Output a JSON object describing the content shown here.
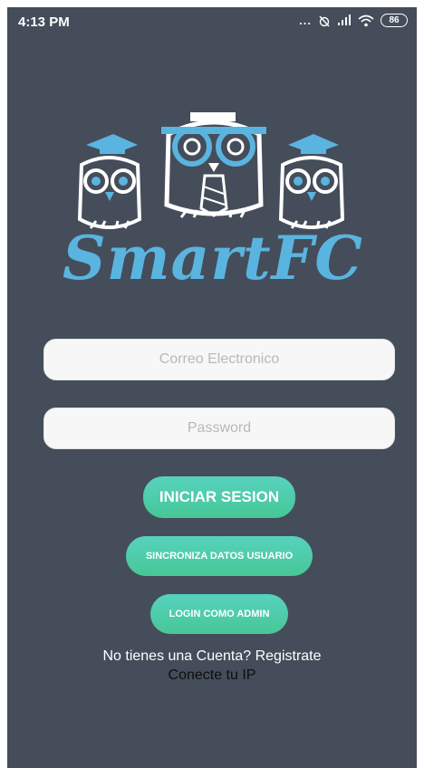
{
  "status_bar": {
    "time": "4:13 PM",
    "signal_dots": "...",
    "battery_level": "86"
  },
  "logo": {
    "text": "SmartFC",
    "color": "#5ab4e0"
  },
  "form": {
    "email_placeholder": "Correo Electronico",
    "password_placeholder": "Password"
  },
  "buttons": {
    "login_label": "INICIAR SESION",
    "sync_label": "SINCRONIZA DATOS USUARIO",
    "admin_label": "LOGIN COMO ADMIN"
  },
  "links": {
    "register": "No tienes una Cuenta? Registrate",
    "connect_ip": "Conecte tu IP"
  },
  "colors": {
    "background": "#454d5a",
    "button_gradient_top": "#57d2bf",
    "button_gradient_bottom": "#47c796"
  },
  "icons": [
    "alarm-off-icon",
    "signal-icon",
    "wifi-icon",
    "battery-icon",
    "owl-logo-icon"
  ]
}
